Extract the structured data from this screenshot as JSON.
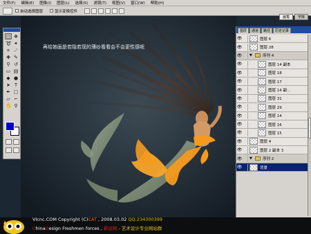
{
  "menu": [
    "文件(F)",
    "编辑(E)",
    "图像(I)",
    "图层(L)",
    "选择(S)",
    "滤镜(T)",
    "视图(V)",
    "窗口(W)",
    "帮助(H)"
  ],
  "options": {
    "auto_select": "自动选择图层",
    "show_bounds": "显示变换控件"
  },
  "wells": [
    "画笔",
    "字库"
  ],
  "caption": "再给她画是若隐若现的薄纱看看会不会更性感呢",
  "panel_tabs": [
    "图层",
    "通道",
    "路径",
    "历史记录"
  ],
  "layers": [
    {
      "name": "图层 6",
      "type": "layer",
      "eye": "👁"
    },
    {
      "name": "图层 28",
      "type": "layer",
      "eye": "👁"
    },
    {
      "name": "序列 4",
      "type": "group",
      "eye": "👁"
    },
    {
      "name": "图层 14 副本",
      "type": "nested",
      "eye": "👁"
    },
    {
      "name": "图层 18",
      "type": "nested",
      "eye": "👁"
    },
    {
      "name": "图层 17",
      "type": "nested",
      "eye": "👁"
    },
    {
      "name": "图层 14 副...",
      "type": "nested",
      "eye": "👁"
    },
    {
      "name": "图层 31",
      "type": "nested",
      "eye": "👁"
    },
    {
      "name": "图层 29",
      "type": "nested",
      "eye": "👁"
    },
    {
      "name": "图层 14",
      "type": "nested",
      "eye": "👁"
    },
    {
      "name": "图层 16",
      "type": "nested",
      "eye": "👁"
    },
    {
      "name": "图层 15",
      "type": "nested",
      "eye": "👁"
    },
    {
      "name": "图层 4",
      "type": "layer",
      "eye": "👁"
    },
    {
      "name": "图层 2 副本 3",
      "type": "layer",
      "eye": "👁"
    },
    {
      "name": "序列 2",
      "type": "group",
      "eye": "👁"
    },
    {
      "name": "背景",
      "type": "selected",
      "eye": "👁"
    }
  ],
  "footer": {
    "line1_a": "VIcnc.COM   Copyright (C)",
    "line1_cat": "CAT",
    "line1_b": " , 2008.03.02   ",
    "line1_qq": "QQ:234300399",
    "line2_c": "C",
    "line2_a": "hina",
    "line2_d": "D",
    "line2_b": "esign Freshmen forces , ",
    "line2_red": "新设网",
    "line2_y": " - 艺术设计专业网站群"
  },
  "colors": {
    "foreground": "#0000c8",
    "background": "#ffffff",
    "accent": "#f59a1e"
  }
}
